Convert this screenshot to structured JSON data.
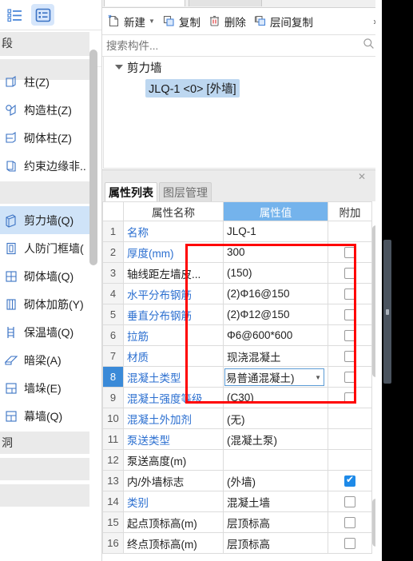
{
  "left_panel": {
    "view_buttons": [
      {
        "name": "list-view-button",
        "icon": "list-view-icon",
        "selected": false
      },
      {
        "name": "detail-view-button",
        "icon": "detail-view-icon",
        "selected": true
      }
    ],
    "header_group_label": "段",
    "items": [
      {
        "label": "柱(Z)",
        "icon": "column-icon",
        "selected": false
      },
      {
        "label": "构造柱(Z)",
        "icon": "constructional-column-icon",
        "selected": false
      },
      {
        "label": "砌体柱(Z)",
        "icon": "masonry-column-icon",
        "selected": false
      },
      {
        "label": "约束边缘非..",
        "icon": "constrained-edge-icon",
        "selected": false
      }
    ],
    "group_label_wall": "",
    "items2": [
      {
        "label": "剪力墙(Q)",
        "icon": "shear-wall-icon",
        "selected": true
      },
      {
        "label": "人防门框墙(",
        "icon": "door-frame-wall-icon",
        "selected": false
      },
      {
        "label": "砌体墙(Q)",
        "icon": "masonry-wall-icon",
        "selected": false
      },
      {
        "label": "砌体加筋(Y)",
        "icon": "masonry-reinforcement-icon",
        "selected": false
      },
      {
        "label": "保温墙(Q)",
        "icon": "insulation-wall-icon",
        "selected": false
      },
      {
        "label": "暗梁(A)",
        "icon": "concealed-beam-icon",
        "selected": false
      },
      {
        "label": "墙垛(E)",
        "icon": "wall-pier-icon",
        "selected": false
      },
      {
        "label": "幕墙(Q)",
        "icon": "curtain-wall-icon",
        "selected": false
      }
    ],
    "group_label_opening": "洞"
  },
  "main": {
    "top_tabs": [
      {
        "label": "",
        "active": true
      },
      {
        "label": "",
        "active": false
      }
    ],
    "toolbar": {
      "buttons": [
        {
          "label": "新建",
          "icon": "new-file-icon",
          "has_caret": true
        },
        {
          "label": "复制",
          "icon": "copy-icon",
          "has_caret": false
        },
        {
          "label": "删除",
          "icon": "delete-trash-icon",
          "has_caret": false
        },
        {
          "label": "层间复制",
          "icon": "copy-between-floors-icon",
          "has_caret": false
        }
      ],
      "overflow_label": "»"
    },
    "search": {
      "placeholder": "搜索构件...",
      "value": "",
      "icon": "search-icon"
    },
    "tree": {
      "root_label": "剪力墙",
      "root_expanded": true,
      "child_label": "JLQ-1 <0> [外墙]",
      "child_selected": true
    }
  },
  "properties": {
    "close_icon": "close-icon",
    "tabs": [
      {
        "label": "属性列表",
        "active": true
      },
      {
        "label": "图层管理",
        "active": false
      }
    ],
    "headers": {
      "index": "",
      "name": "属性名称",
      "value": "属性值",
      "attach": "附加"
    },
    "rows": [
      {
        "index": "1",
        "name": "名称",
        "name_link": true,
        "value": "JLQ-1",
        "attach": "none",
        "selected": false,
        "editing": false
      },
      {
        "index": "2",
        "name": "厚度(mm)",
        "name_link": true,
        "value": "300",
        "attach": "unchecked",
        "selected": false,
        "editing": false
      },
      {
        "index": "3",
        "name": "轴线距左墙皮...",
        "name_link": false,
        "value": "(150)",
        "attach": "unchecked",
        "selected": false,
        "editing": false
      },
      {
        "index": "4",
        "name": "水平分布钢筋",
        "name_link": true,
        "value": "(2)Φ16@150",
        "attach": "unchecked",
        "selected": false,
        "editing": false
      },
      {
        "index": "5",
        "name": "垂直分布钢筋",
        "name_link": true,
        "value": "(2)Φ12@150",
        "attach": "unchecked",
        "selected": false,
        "editing": false
      },
      {
        "index": "6",
        "name": "拉筋",
        "name_link": true,
        "value": "Φ6@600*600",
        "attach": "unchecked",
        "selected": false,
        "editing": false
      },
      {
        "index": "7",
        "name": "材质",
        "name_link": true,
        "value": "现浇混凝土",
        "attach": "unchecked",
        "selected": false,
        "editing": false
      },
      {
        "index": "8",
        "name": "混凝土类型",
        "name_link": true,
        "value": "易普通混凝土)",
        "attach": "unchecked",
        "selected": true,
        "editing": true
      },
      {
        "index": "9",
        "name": "混凝土强度等级",
        "name_link": true,
        "value": "(C30)",
        "attach": "unchecked",
        "selected": false,
        "editing": false
      },
      {
        "index": "10",
        "name": "混凝土外加剂",
        "name_link": true,
        "value": "(无)",
        "attach": "none",
        "selected": false,
        "editing": false
      },
      {
        "index": "11",
        "name": "泵送类型",
        "name_link": true,
        "value": "(混凝土泵)",
        "attach": "none",
        "selected": false,
        "editing": false
      },
      {
        "index": "12",
        "name": "泵送高度(m)",
        "name_link": false,
        "value": "",
        "attach": "none",
        "selected": false,
        "editing": false
      },
      {
        "index": "13",
        "name": "内/外墙标志",
        "name_link": false,
        "value": "(外墙)",
        "attach": "checked",
        "selected": false,
        "editing": false
      },
      {
        "index": "14",
        "name": "类别",
        "name_link": true,
        "value": "混凝土墙",
        "attach": "unchecked",
        "selected": false,
        "editing": false
      },
      {
        "index": "15",
        "name": "起点顶标高(m)",
        "name_link": false,
        "value": "层顶标高",
        "attach": "unchecked",
        "selected": false,
        "editing": false
      },
      {
        "index": "16",
        "name": "终点顶标高(m)",
        "name_link": false,
        "value": "层顶标高",
        "attach": "unchecked",
        "selected": false,
        "editing": false
      }
    ]
  },
  "annotation": {
    "highlight_color": "#ff0000",
    "shape": "rectangle"
  },
  "colors": {
    "accent_blue": "#74b3ec",
    "selected_row": "#3a8ad8",
    "tree_select": "#bdd7f0",
    "sidebar_select": "#cfe3f8",
    "annotation_red": "#ff0000"
  }
}
